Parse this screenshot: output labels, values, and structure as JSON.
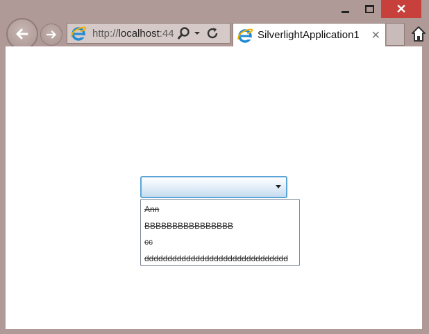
{
  "window": {
    "controls": {
      "minimize_icon": "minimize-icon",
      "maximize_icon": "maximize-icon",
      "close_label": "✕"
    }
  },
  "browser": {
    "address": {
      "prefix": "http://",
      "host": "localhost",
      "port_fragment": ":44"
    },
    "tab": {
      "title": "SilverlightApplication1",
      "close_label": "✕"
    }
  },
  "combobox": {
    "selected_value": "",
    "options": [
      "Ann",
      "BBBBBBBBBBBBBBBB",
      "cc",
      "ddddddddddddddddddddddddddddddd"
    ]
  },
  "colors": {
    "chrome_bg": "#b09a97",
    "close_button": "#c7403b",
    "combo_border": "#5aa6d8"
  }
}
